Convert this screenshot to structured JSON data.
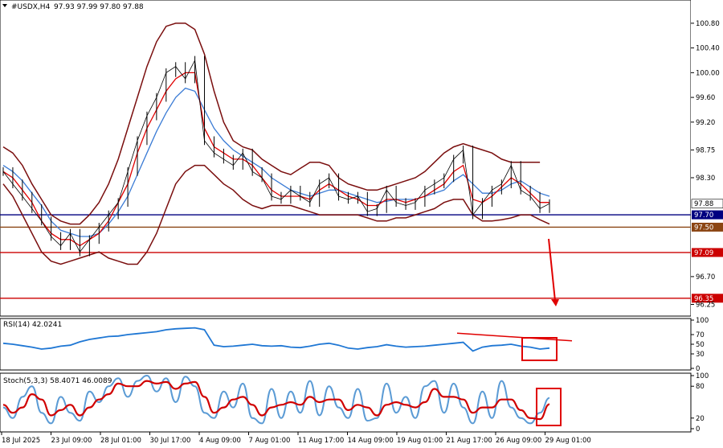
{
  "header": {
    "symbol_label": "#USDX,H4",
    "ohlc": "97.93 97.99 97.80 97.88"
  },
  "indicators": {
    "rsi_label": "RSI(14) 42.0241",
    "stoch_label": "Stoch(5,3,3) 58.4071 46.0089"
  },
  "colors": {
    "background": "#ffffff",
    "price_line": "#000000",
    "ma_fast": "#e00000",
    "ma_slow": "#3a7bd5",
    "bollinger": "#7a0e0e",
    "level_blue": "#000080",
    "level_brown": "#8b4513",
    "level_red": "#cc0000",
    "rsi_line": "#1f77d4",
    "stoch_main": "#5b9bd5",
    "stoch_signal": "#d00000",
    "annotation": "#e00000"
  },
  "chart_data": [
    {
      "type": "line",
      "name": "main",
      "ylim": [
        96.1,
        101.15
      ],
      "price_ticks": [
        "100.80",
        "100.40",
        "100.00",
        "99.60",
        "99.20",
        "98.75",
        "98.30",
        "97.88",
        "97.70",
        "97.50",
        "97.09",
        "96.70",
        "96.35",
        "96.25"
      ],
      "levels": [
        {
          "value": 97.7,
          "label": "97.70",
          "color": "#000080"
        },
        {
          "value": 97.5,
          "label": "97.50",
          "color": "#8b4513"
        },
        {
          "value": 97.09,
          "label": "97.09",
          "color": "#cc0000"
        },
        {
          "value": 96.35,
          "label": "96.35",
          "color": "#cc0000"
        }
      ],
      "current_price": {
        "value": 97.88,
        "label": "97.88"
      },
      "x_labels": [
        "18 Jul 2025",
        "23 Jul 09:00",
        "28 Jul 01:00",
        "30 Jul 17:00",
        "4 Aug 09:00",
        "7 Aug 01:00",
        "11 Aug 17:00",
        "14 Aug 09:00",
        "19 Aug 01:00",
        "21 Aug 17:00",
        "26 Aug 09:00",
        "29 Aug 01:00"
      ],
      "series": [
        {
          "values": [
            98.4,
            98.2,
            98.0,
            97.8,
            97.6,
            97.35,
            97.2,
            97.4,
            97.1,
            97.3,
            97.5,
            97.7,
            97.9,
            98.4,
            98.9,
            99.3,
            99.6,
            100.0,
            100.1,
            99.9,
            100.2,
            98.9,
            98.7,
            98.6,
            98.5,
            98.7,
            98.4,
            98.3,
            98.0,
            97.95,
            98.1,
            98.0,
            97.9,
            98.2,
            98.3,
            98.0,
            97.95,
            98.0,
            97.75,
            97.8,
            98.1,
            97.9,
            97.85,
            97.9,
            98.1,
            98.2,
            98.3,
            98.6,
            98.75,
            97.7,
            97.9,
            98.1,
            98.2,
            98.5,
            98.1,
            98.0,
            97.8,
            97.88
          ]
        },
        {
          "values": [
            98.4,
            98.3,
            98.1,
            97.9,
            97.6,
            97.4,
            97.3,
            97.3,
            97.2,
            97.3,
            97.4,
            97.6,
            97.9,
            98.2,
            98.7,
            99.1,
            99.4,
            99.7,
            99.9,
            100.0,
            100.0,
            99.1,
            98.8,
            98.7,
            98.6,
            98.6,
            98.5,
            98.3,
            98.1,
            98.0,
            98.0,
            98.0,
            97.95,
            98.1,
            98.2,
            98.1,
            98.0,
            97.95,
            97.85,
            97.85,
            97.95,
            97.95,
            97.9,
            97.95,
            98.0,
            98.1,
            98.2,
            98.4,
            98.5,
            97.95,
            97.9,
            98.0,
            98.15,
            98.3,
            98.2,
            98.05,
            97.9,
            97.9
          ]
        },
        {
          "values": [
            98.5,
            98.4,
            98.25,
            98.05,
            97.85,
            97.6,
            97.45,
            97.4,
            97.35,
            97.35,
            97.4,
            97.55,
            97.75,
            98.0,
            98.35,
            98.7,
            99.05,
            99.35,
            99.6,
            99.75,
            99.7,
            99.4,
            99.1,
            98.9,
            98.75,
            98.65,
            98.55,
            98.45,
            98.3,
            98.2,
            98.1,
            98.05,
            98.0,
            98.05,
            98.1,
            98.1,
            98.05,
            98.0,
            97.95,
            97.9,
            97.92,
            97.95,
            97.95,
            97.95,
            98.0,
            98.05,
            98.1,
            98.25,
            98.35,
            98.2,
            98.05,
            98.05,
            98.1,
            98.2,
            98.25,
            98.15,
            98.05,
            98.0
          ]
        },
        {
          "values": [
            98.8,
            98.7,
            98.5,
            98.2,
            97.95,
            97.7,
            97.6,
            97.55,
            97.55,
            97.7,
            97.9,
            98.2,
            98.6,
            99.1,
            99.6,
            100.1,
            100.5,
            100.75,
            100.8,
            100.8,
            100.7,
            100.3,
            99.7,
            99.2,
            98.9,
            98.8,
            98.75,
            98.6,
            98.5,
            98.4,
            98.35,
            98.45,
            98.55,
            98.55,
            98.5,
            98.3,
            98.2,
            98.15,
            98.1,
            98.1,
            98.15,
            98.2,
            98.25,
            98.3,
            98.4,
            98.55,
            98.7,
            98.8,
            98.85,
            98.8,
            98.75,
            98.7,
            98.6,
            98.55,
            98.55,
            98.55,
            98.55
          ]
        },
        {
          "values": [
            98.2,
            98.0,
            97.7,
            97.4,
            97.1,
            96.95,
            96.9,
            96.95,
            97.0,
            97.05,
            97.1,
            97.0,
            96.95,
            96.9,
            96.9,
            97.1,
            97.4,
            97.8,
            98.2,
            98.4,
            98.5,
            98.5,
            98.35,
            98.2,
            98.1,
            97.95,
            97.85,
            97.8,
            97.85,
            97.85,
            97.85,
            97.8,
            97.75,
            97.7,
            97.7,
            97.7,
            97.7,
            97.7,
            97.65,
            97.6,
            97.6,
            97.65,
            97.65,
            97.7,
            97.75,
            97.8,
            97.9,
            97.95,
            97.95,
            97.7,
            97.6,
            97.6,
            97.62,
            97.65,
            97.7,
            97.7,
            97.62,
            97.55
          ]
        }
      ]
    },
    {
      "type": "line",
      "name": "rsi",
      "ylim": [
        0,
        100
      ],
      "ticks": [
        "100",
        "70",
        "50",
        "30",
        "0"
      ],
      "series": [
        {
          "values": [
            52,
            50,
            47,
            44,
            40,
            42,
            46,
            48,
            55,
            60,
            63,
            66,
            67,
            70,
            72,
            74,
            76,
            80,
            82,
            83,
            84,
            80,
            48,
            45,
            46,
            48,
            50,
            47,
            46,
            47,
            44,
            43,
            46,
            50,
            52,
            48,
            42,
            40,
            43,
            45,
            49,
            46,
            44,
            45,
            46,
            48,
            50,
            52,
            54,
            36,
            44,
            47,
            48,
            50,
            46,
            44,
            40,
            42
          ]
        }
      ],
      "trendline": [
        [
          55,
          73
        ],
        [
          66,
          57
        ]
      ]
    },
    {
      "type": "line",
      "name": "stochastic",
      "ylim": [
        0,
        100
      ],
      "ticks": [
        "100",
        "80",
        "20",
        "0"
      ],
      "series": [
        {
          "values": [
            40,
            20,
            60,
            80,
            30,
            10,
            60,
            30,
            15,
            70,
            50,
            80,
            95,
            60,
            90,
            100,
            70,
            95,
            50,
            98,
            80,
            30,
            20,
            70,
            40,
            85,
            20,
            10,
            75,
            20,
            70,
            30,
            90,
            25,
            80,
            40,
            20,
            75,
            15,
            20,
            85,
            30,
            60,
            20,
            80,
            90,
            30,
            85,
            40,
            10,
            70,
            20,
            90,
            40,
            20,
            10,
            30,
            58
          ]
        },
        {
          "values": [
            45,
            30,
            40,
            65,
            55,
            25,
            35,
            45,
            25,
            40,
            55,
            65,
            85,
            80,
            80,
            90,
            85,
            88,
            75,
            85,
            88,
            60,
            30,
            40,
            55,
            60,
            45,
            25,
            40,
            45,
            50,
            45,
            60,
            50,
            55,
            55,
            35,
            45,
            40,
            25,
            45,
            50,
            45,
            40,
            50,
            75,
            60,
            60,
            55,
            30,
            40,
            40,
            55,
            55,
            35,
            20,
            18,
            46
          ]
        }
      ]
    }
  ]
}
